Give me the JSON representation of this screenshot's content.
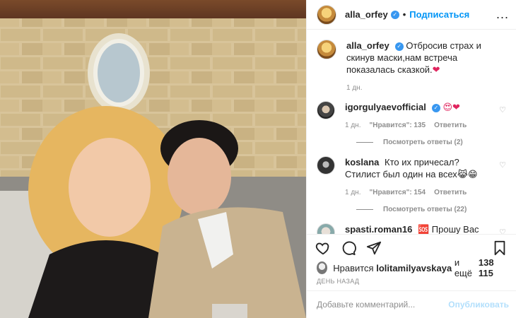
{
  "header": {
    "username": "alla_orfey",
    "follow_label": "Подписаться",
    "more_label": "..."
  },
  "caption": {
    "username": "alla_orfey",
    "text": "Отбросив страх и скинув маски,нам встреча показалась сказкой.",
    "emoji": "❤",
    "time": "1 дн."
  },
  "comments": [
    {
      "username": "igorgulyaevofficial",
      "text": "",
      "emoji": "😍❤",
      "time": "1 дн.",
      "likes": "\"Нравится\": 135",
      "reply": "Ответить",
      "replies": "Посмотреть ответы (2)"
    },
    {
      "username": "koslana",
      "text": "Кто их причесал? Стилист был один на всех",
      "emoji": "😹😁",
      "time": "1 дн.",
      "likes": "\"Нравится\": 154",
      "reply": "Ответить",
      "replies": "Посмотреть ответы (22)"
    },
    {
      "username": "spasti.roman16",
      "text": "🆘 Прошу Вас"
    }
  ],
  "likes": {
    "prefix": "Нравится",
    "user": "lolitamilyavskaya",
    "middle": "и ещё",
    "count": "138 115"
  },
  "date": "ДЕНЬ НАЗАД",
  "add_comment": {
    "placeholder": "Добавьте комментарий...",
    "publish_label": "Опубликовать"
  },
  "icons": {
    "verified": "✓",
    "heart_small": "♡"
  }
}
